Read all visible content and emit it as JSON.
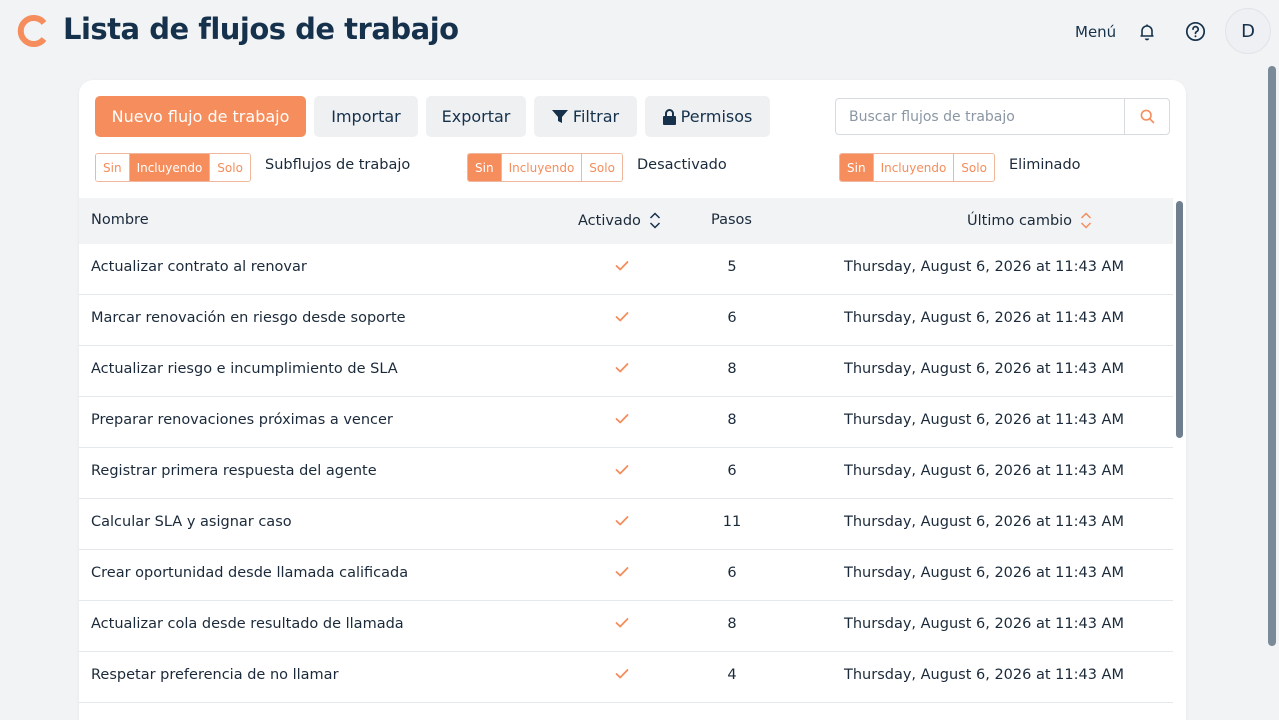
{
  "header": {
    "title": "Lista de flujos de trabajo",
    "menu_label": "Menú",
    "avatar_initial": "D",
    "logo_color": "#f58d5c"
  },
  "toolbar": {
    "new_label": "Nuevo flujo de trabajo",
    "import_label": "Importar",
    "export_label": "Exportar",
    "filter_label": "Filtrar",
    "permissions_label": "Permisos",
    "search_placeholder": "Buscar flujos de trabajo"
  },
  "filters": [
    {
      "options": [
        "Sin",
        "Incluyendo",
        "Solo"
      ],
      "selected": "Incluyendo",
      "label": "Subflujos de trabajo"
    },
    {
      "options": [
        "Sin",
        "Incluyendo",
        "Solo"
      ],
      "selected": "Sin",
      "label": "Desactivado"
    },
    {
      "options": [
        "Sin",
        "Incluyendo",
        "Solo"
      ],
      "selected": "Sin",
      "label": "Eliminado"
    }
  ],
  "table": {
    "columns": {
      "name": "Nombre",
      "enabled": "Activado",
      "steps": "Pasos",
      "changed": "Último cambio"
    },
    "rows": [
      {
        "name": "Actualizar contrato al renovar",
        "enabled": true,
        "steps": "5",
        "changed": "Thursday, August 6, 2026 at 11:43 AM"
      },
      {
        "name": "Marcar renovación en riesgo desde soporte",
        "enabled": true,
        "steps": "6",
        "changed": "Thursday, August 6, 2026 at 11:43 AM"
      },
      {
        "name": "Actualizar riesgo e incumplimiento de SLA",
        "enabled": true,
        "steps": "8",
        "changed": "Thursday, August 6, 2026 at 11:43 AM"
      },
      {
        "name": "Preparar renovaciones próximas a vencer",
        "enabled": true,
        "steps": "8",
        "changed": "Thursday, August 6, 2026 at 11:43 AM"
      },
      {
        "name": "Registrar primera respuesta del agente",
        "enabled": true,
        "steps": "6",
        "changed": "Thursday, August 6, 2026 at 11:43 AM"
      },
      {
        "name": "Calcular SLA y asignar caso",
        "enabled": true,
        "steps": "11",
        "changed": "Thursday, August 6, 2026 at 11:43 AM"
      },
      {
        "name": "Crear oportunidad desde llamada calificada",
        "enabled": true,
        "steps": "6",
        "changed": "Thursday, August 6, 2026 at 11:43 AM"
      },
      {
        "name": "Actualizar cola desde resultado de llamada",
        "enabled": true,
        "steps": "8",
        "changed": "Thursday, August 6, 2026 at 11:43 AM"
      },
      {
        "name": "Respetar preferencia de no llamar",
        "enabled": true,
        "steps": "4",
        "changed": "Thursday, August 6, 2026 at 11:43 AM"
      }
    ]
  },
  "colors": {
    "accent": "#f58d5c",
    "heading": "#16314b",
    "check": "#f58d5c"
  },
  "icons": [
    "bell-icon",
    "help-icon",
    "filter-icon",
    "lock-icon",
    "search-icon",
    "sort-icon",
    "check-icon"
  ]
}
